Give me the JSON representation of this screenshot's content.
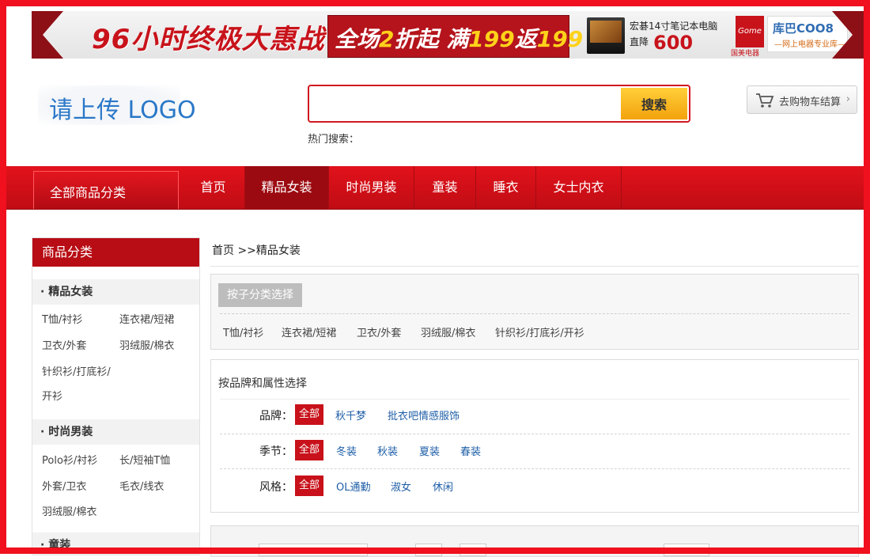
{
  "banner": {
    "promo_title": "96小时终极大惠战",
    "promo_offer_pre": "全场",
    "promo_offer_num": "2",
    "promo_offer_mid": "折起 满",
    "promo_offer_amt1": "199",
    "promo_offer_mid2": "返",
    "promo_offer_amt2": "199",
    "laptop_name": "宏碁14寸笔记本电脑",
    "laptop_price_label": "直降",
    "laptop_price": "600",
    "guomei_name": "Gome",
    "guomei_sub": "国美电器",
    "coo8_name": "库巴COO8",
    "coo8_sub": "—网上电器专业库—"
  },
  "header": {
    "logo_text": "请上传 LOGO",
    "search_placeholder": "",
    "search_button": "搜索",
    "hot_search_label": "热门搜索：",
    "cart_label": "去购物车结算",
    "cart_arrow": "›"
  },
  "nav": {
    "all_categories": "全部商品分类",
    "items": [
      "首页",
      "精品女装",
      "时尚男装",
      "童装",
      "睡衣",
      "女士内衣"
    ]
  },
  "sidebar": {
    "title": "商品分类",
    "categories": [
      {
        "title": "精品女装",
        "links": [
          "T恤/衬衫",
          "连衣裙/短裙",
          "卫衣/外套",
          "羽绒服/棉衣",
          "针织衫/打底衫/",
          "开衫"
        ]
      },
      {
        "title": "时尚男装",
        "links": [
          "Polo衫/衬衫",
          "长/短袖T恤",
          "外套/卫衣",
          "毛衣/线衣",
          "羽绒服/棉衣"
        ]
      },
      {
        "title": "童装",
        "links": []
      }
    ]
  },
  "main": {
    "breadcrumb": "首页  >>精品女装",
    "subcategory_tag": "按子分类选择",
    "subcategories": [
      "T恤/衬衫",
      "连衣裙/短裙",
      "卫衣/外套",
      "羽绒服/棉衣",
      "针织衫/打底衫/开衫"
    ],
    "attr_title": "按品牌和属性选择",
    "attributes": [
      {
        "label": "品牌：",
        "all": "全部",
        "options": [
          "秋千梦",
          "批衣吧情感服饰"
        ]
      },
      {
        "label": "季节：",
        "all": "全部",
        "options": [
          "冬装",
          "秋装",
          "夏装",
          "春装"
        ]
      },
      {
        "label": "风格：",
        "all": "全部",
        "options": [
          "OL通勤",
          "淑女",
          "休闲"
        ]
      }
    ]
  },
  "colors": {
    "brand_red": "#e2121b",
    "frame_red": "#f0101e",
    "link_blue": "#1f5fa8",
    "search_button": "#f3a20c"
  }
}
